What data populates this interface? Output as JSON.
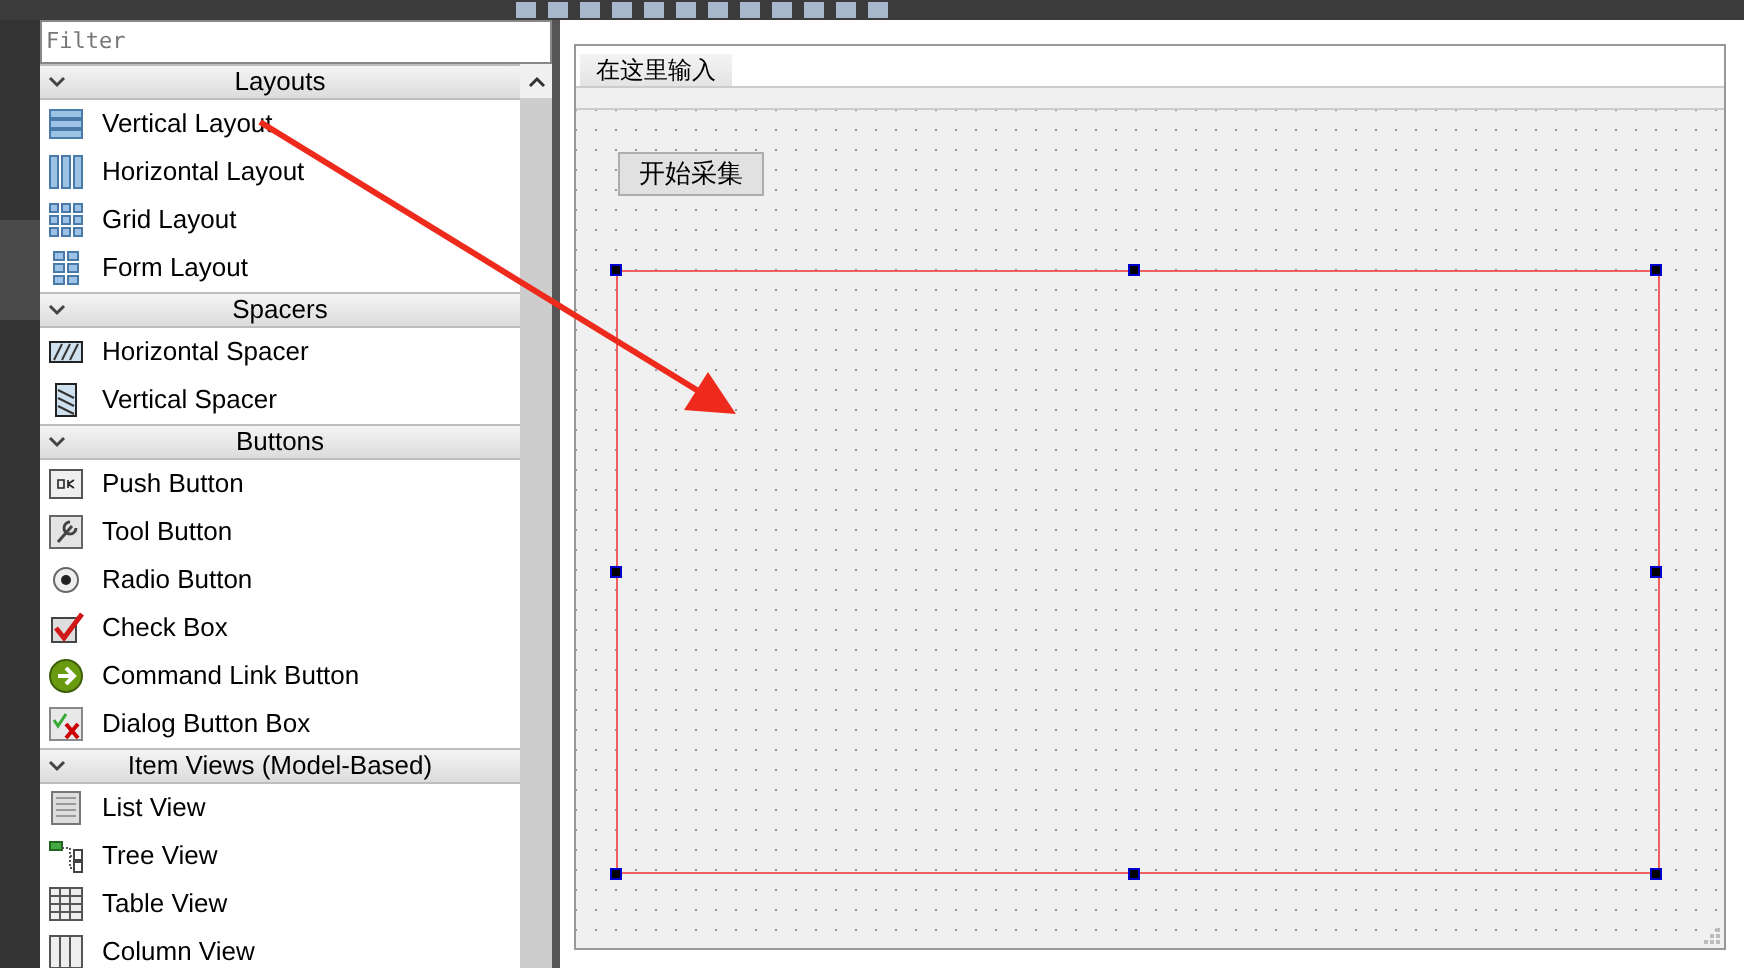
{
  "widget_box": {
    "filter": {
      "placeholder": "Filter"
    },
    "categories": [
      {
        "title": "Layouts",
        "expanded": true,
        "items": [
          {
            "label": "Vertical Layout",
            "kind": "vlayout"
          },
          {
            "label": "Horizontal Layout",
            "kind": "hlayout"
          },
          {
            "label": "Grid Layout",
            "kind": "grid"
          },
          {
            "label": "Form Layout",
            "kind": "form"
          }
        ]
      },
      {
        "title": "Spacers",
        "expanded": true,
        "items": [
          {
            "label": "Horizontal Spacer",
            "kind": "hspacer"
          },
          {
            "label": "Vertical Spacer",
            "kind": "vspacer"
          }
        ]
      },
      {
        "title": "Buttons",
        "expanded": true,
        "items": [
          {
            "label": "Push Button",
            "kind": "push"
          },
          {
            "label": "Tool Button",
            "kind": "tool"
          },
          {
            "label": "Radio Button",
            "kind": "radio"
          },
          {
            "label": "Check Box",
            "kind": "check"
          },
          {
            "label": "Command Link Button",
            "kind": "cmdlink"
          },
          {
            "label": "Dialog Button Box",
            "kind": "dialog"
          }
        ]
      },
      {
        "title": "Item Views (Model-Based)",
        "expanded": true,
        "items": [
          {
            "label": "List View",
            "kind": "list"
          },
          {
            "label": "Tree View",
            "kind": "tree"
          },
          {
            "label": "Table View",
            "kind": "table"
          },
          {
            "label": "Column View",
            "kind": "column"
          }
        ]
      }
    ]
  },
  "form": {
    "menu_items": [
      "在这里输入"
    ],
    "button": "开始采集"
  }
}
